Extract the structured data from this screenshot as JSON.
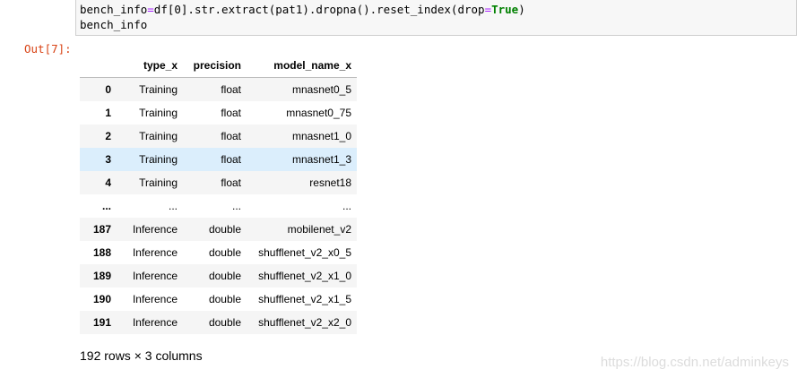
{
  "input_cell": {
    "line1": {
      "a": "bench_info",
      "b": "=",
      "c": "df[0].str.extract(pat1).dropna().reset_index(drop",
      "d": "=",
      "e": "True",
      "f": ")"
    },
    "line2": "bench_info"
  },
  "output_prompt": "Out[7]:",
  "dataframe": {
    "columns": [
      "",
      "type_x",
      "precision",
      "model_name_x"
    ],
    "rows": [
      {
        "index": "0",
        "type_x": "Training",
        "precision": "float",
        "model_name_x": "mnasnet0_5"
      },
      {
        "index": "1",
        "type_x": "Training",
        "precision": "float",
        "model_name_x": "mnasnet0_75"
      },
      {
        "index": "2",
        "type_x": "Training",
        "precision": "float",
        "model_name_x": "mnasnet1_0"
      },
      {
        "index": "3",
        "type_x": "Training",
        "precision": "float",
        "model_name_x": "mnasnet1_3"
      },
      {
        "index": "4",
        "type_x": "Training",
        "precision": "float",
        "model_name_x": "resnet18"
      },
      {
        "index": "...",
        "type_x": "...",
        "precision": "...",
        "model_name_x": "..."
      },
      {
        "index": "187",
        "type_x": "Inference",
        "precision": "double",
        "model_name_x": "mobilenet_v2"
      },
      {
        "index": "188",
        "type_x": "Inference",
        "precision": "double",
        "model_name_x": "shufflenet_v2_x0_5"
      },
      {
        "index": "189",
        "type_x": "Inference",
        "precision": "double",
        "model_name_x": "shufflenet_v2_x1_0"
      },
      {
        "index": "190",
        "type_x": "Inference",
        "precision": "double",
        "model_name_x": "shufflenet_v2_x1_5"
      },
      {
        "index": "191",
        "type_x": "Inference",
        "precision": "double",
        "model_name_x": "shufflenet_v2_x2_0"
      }
    ],
    "shape_text": "192 rows × 3 columns"
  },
  "watermark": "https://blog.csdn.net/adminkeys",
  "colors": {
    "output_prompt": "#d84315",
    "row_highlight": "#dbeefc",
    "keyword": "#008000",
    "operator": "#aa22ff"
  }
}
